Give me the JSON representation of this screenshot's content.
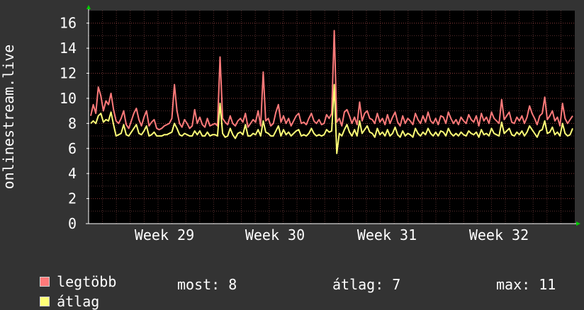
{
  "chart_data": {
    "type": "line",
    "ylabel": "onlinestream.live",
    "ylim": [
      0,
      17
    ],
    "y_ticks": [
      "0",
      "2",
      "4",
      "6",
      "8",
      "10",
      "12",
      "14",
      "16"
    ],
    "x_ticks": [
      "Week 29",
      "Week 30",
      "Week 31",
      "Week 32"
    ],
    "grid": true,
    "series": [
      {
        "name": "legtöbb",
        "color": "#ff7a7a",
        "values": [
          8.6,
          9.5,
          8.8,
          10.9,
          10.2,
          9.0,
          9.8,
          9.5,
          10.4,
          9.1,
          8.2,
          8.0,
          8.4,
          9.0,
          7.9,
          7.6,
          8.2,
          8.8,
          9.2,
          8.3,
          7.8,
          8.5,
          9.0,
          7.8,
          8.1,
          8.3,
          7.6,
          7.5,
          7.6,
          7.8,
          7.9,
          8.0,
          8.4,
          11.1,
          9.0,
          8.0,
          7.7,
          8.3,
          8.0,
          7.6,
          7.8,
          9.1,
          8.0,
          8.5,
          7.9,
          7.7,
          8.4,
          7.8,
          7.9,
          8.0,
          7.8,
          13.3,
          8.4,
          8.1,
          7.9,
          8.6,
          8.0,
          7.8,
          8.2,
          8.4,
          8.1,
          8.8,
          7.7,
          8.0,
          8.3,
          8.1,
          9.0,
          7.8,
          12.1,
          8.2,
          8.4,
          7.8,
          8.0,
          8.9,
          9.5,
          8.1,
          8.6,
          8.0,
          8.4,
          7.8,
          8.2,
          8.6,
          8.8,
          8.0,
          8.1,
          7.9,
          8.4,
          8.8,
          8.2,
          8.0,
          8.3,
          7.9,
          8.0,
          8.7,
          8.4,
          8.8,
          15.4,
          8.1,
          8.4,
          7.8,
          8.9,
          9.1,
          8.6,
          8.0,
          8.5,
          7.9,
          9.7,
          8.2,
          8.8,
          9.0,
          8.4,
          8.3,
          8.0,
          8.8,
          8.1,
          8.4,
          7.9,
          8.7,
          8.0,
          8.5,
          8.9,
          8.1,
          7.8,
          8.6,
          8.0,
          8.4,
          8.2,
          7.9,
          8.8,
          8.3,
          8.0,
          8.6,
          8.1,
          8.9,
          8.2,
          8.0,
          8.4,
          7.9,
          8.6,
          8.5,
          8.0,
          8.9,
          8.4,
          8.0,
          8.3,
          7.9,
          8.5,
          8.2,
          8.0,
          8.7,
          8.3,
          8.1,
          8.6,
          7.8,
          8.8,
          8.2,
          8.5,
          8.0,
          8.9,
          8.4,
          8.2,
          8.0,
          9.9,
          8.3,
          8.6,
          8.9,
          8.1,
          8.0,
          8.5,
          8.2,
          8.6,
          8.0,
          8.5,
          9.4,
          8.8,
          8.4,
          7.9,
          8.6,
          8.8,
          10.1,
          8.3,
          8.6,
          9.0,
          8.2,
          8.5,
          7.8,
          9.6,
          8.4,
          8.0,
          8.3,
          8.6
        ]
      },
      {
        "name": "átlag",
        "color": "#ffff77",
        "values": [
          8.0,
          8.2,
          8.0,
          8.6,
          8.8,
          8.1,
          8.3,
          8.2,
          8.9,
          7.9,
          7.0,
          7.1,
          7.2,
          7.9,
          7.1,
          7.0,
          7.3,
          7.6,
          7.9,
          7.2,
          7.1,
          7.4,
          7.8,
          7.0,
          7.1,
          7.3,
          7.0,
          7.0,
          7.0,
          7.1,
          7.1,
          7.2,
          7.3,
          8.0,
          7.6,
          7.1,
          7.0,
          7.2,
          7.1,
          7.0,
          7.0,
          7.4,
          7.1,
          7.4,
          7.0,
          7.0,
          7.3,
          7.0,
          7.1,
          7.1,
          7.0,
          9.6,
          7.2,
          6.9,
          7.0,
          7.6,
          7.1,
          6.8,
          7.2,
          7.3,
          7.1,
          7.9,
          7.0,
          7.0,
          7.2,
          7.1,
          7.5,
          7.0,
          8.2,
          7.3,
          7.2,
          7.0,
          7.0,
          7.4,
          7.8,
          7.0,
          7.5,
          7.1,
          7.3,
          7.0,
          7.2,
          7.4,
          7.5,
          7.0,
          7.1,
          7.0,
          7.2,
          7.6,
          7.2,
          7.0,
          7.1,
          7.0,
          7.1,
          7.5,
          7.3,
          7.4,
          11.1,
          5.6,
          7.2,
          7.0,
          7.5,
          7.9,
          7.3,
          7.0,
          7.5,
          7.0,
          8.2,
          7.2,
          7.5,
          7.8,
          7.3,
          7.2,
          6.9,
          7.6,
          7.1,
          7.3,
          7.0,
          7.5,
          7.0,
          7.2,
          7.7,
          7.1,
          6.9,
          7.4,
          7.0,
          7.2,
          7.1,
          6.9,
          7.6,
          7.2,
          7.0,
          7.3,
          7.1,
          7.6,
          7.2,
          7.0,
          7.3,
          7.0,
          7.4,
          7.3,
          7.0,
          7.6,
          7.2,
          7.0,
          7.2,
          7.0,
          7.3,
          7.1,
          7.0,
          7.4,
          7.2,
          7.1,
          7.3,
          6.9,
          7.5,
          7.1,
          7.2,
          7.0,
          7.6,
          7.2,
          7.1,
          7.0,
          8.1,
          7.2,
          7.4,
          7.6,
          7.1,
          7.0,
          7.3,
          7.1,
          7.4,
          7.0,
          7.3,
          7.8,
          7.5,
          7.2,
          6.9,
          7.4,
          7.5,
          8.2,
          7.2,
          7.3,
          7.7,
          7.1,
          7.3,
          7.0,
          8.0,
          7.2,
          7.0,
          7.1,
          7.6
        ]
      }
    ]
  },
  "legend": {
    "max_label": "legtöbb",
    "avg_label": "átlag",
    "max_color": "#ff7a7a",
    "avg_color": "#ffff77"
  },
  "stats": {
    "now": "most: 8",
    "average": "átlag: 7",
    "max": "max: 11"
  },
  "colors": {
    "background": "#333333",
    "plot_background": "#000000",
    "grid_minor": "#5a3030",
    "grid_major": "#8a3a3a",
    "axis": "#ffffff",
    "arrow": "#00cc00"
  }
}
